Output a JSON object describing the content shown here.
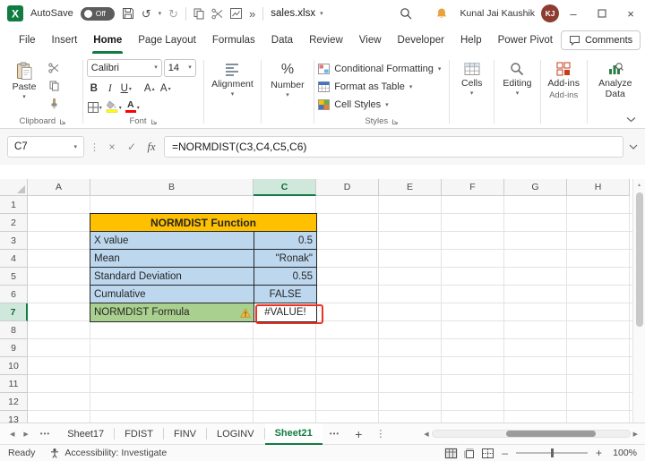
{
  "titlebar": {
    "autosave_label": "AutoSave",
    "autosave_state": "Off",
    "filename": "sales.xlsx",
    "user_name": "Kunal Jai Kaushik",
    "user_initials": "KJ",
    "minimize": "–",
    "close": "×"
  },
  "icons": {
    "caret": "▾",
    "tri_up": "▴",
    "undo": "↺",
    "redo": "↻",
    "more": "»",
    "dots_v": "⋮",
    "tri_left": "◀",
    "tri_right": "▶"
  },
  "menubar": {
    "tabs": [
      "File",
      "Insert",
      "Home",
      "Page Layout",
      "Formulas",
      "Data",
      "Review",
      "View",
      "Developer",
      "Help",
      "Power Pivot"
    ],
    "active_tab": "Home",
    "comments_label": "Comments"
  },
  "ribbon": {
    "paste": "Paste",
    "clipboard_group": "Clipboard",
    "font_name": "Calibri",
    "font_size": "14",
    "bold": "B",
    "italic": "I",
    "underline": "U",
    "letter_a": "A",
    "font_group": "Font",
    "alignment": "Alignment",
    "percent": "%",
    "number": "Number",
    "conditional_formatting": "Conditional Formatting",
    "format_as_table": "Format as Table",
    "cell_styles": "Cell Styles",
    "styles_group": "Styles",
    "cells": "Cells",
    "editing": "Editing",
    "addins": "Add-ins",
    "addins_group": "Add-ins",
    "analyze_data": "Analyze Data"
  },
  "formula_bar": {
    "name_box": "C7",
    "cancel": "×",
    "enter": "✓",
    "fx": "fx",
    "formula": "=NORMDIST(C3,C4,C5,C6)"
  },
  "grid": {
    "columns": [
      "A",
      "B",
      "C",
      "D",
      "E",
      "F",
      "G",
      "H"
    ],
    "rows": [
      "1",
      "2",
      "3",
      "4",
      "5",
      "6",
      "7",
      "8",
      "9",
      "10",
      "11",
      "12",
      "13"
    ],
    "selected_cell": "C7",
    "table_title": "NORMDIST Function",
    "table_rows": [
      {
        "label": "X value",
        "value": "0.5"
      },
      {
        "label": "Mean",
        "value": "\"Ronak\""
      },
      {
        "label": "Standard Deviation",
        "value": "0.55"
      },
      {
        "label": "Cumulative",
        "value": "FALSE"
      },
      {
        "label": "NORMDIST Formula",
        "value": "#VALUE!"
      }
    ]
  },
  "sheet_tabs": {
    "overflow_left": "•••",
    "tabs": [
      "Sheet17",
      "FDIST",
      "FINV",
      "LOGINV",
      "Sheet21"
    ],
    "active_tab": "Sheet21",
    "overflow_right": "•••",
    "add_sheet": "+"
  },
  "status_bar": {
    "ready": "Ready",
    "accessibility": "Accessibility: Investigate",
    "zoom_minus": "–",
    "zoom_plus": "+",
    "zoom_level": "100%"
  },
  "colors": {
    "excel_green": "#107C41",
    "table_header_gold": "#FFC000",
    "input_cells_blue": "#BDD7EE",
    "formula_cell_green": "#A9D08E",
    "error_annotation_red": "#EA3323",
    "avatar_maroon": "#8E3B30"
  }
}
